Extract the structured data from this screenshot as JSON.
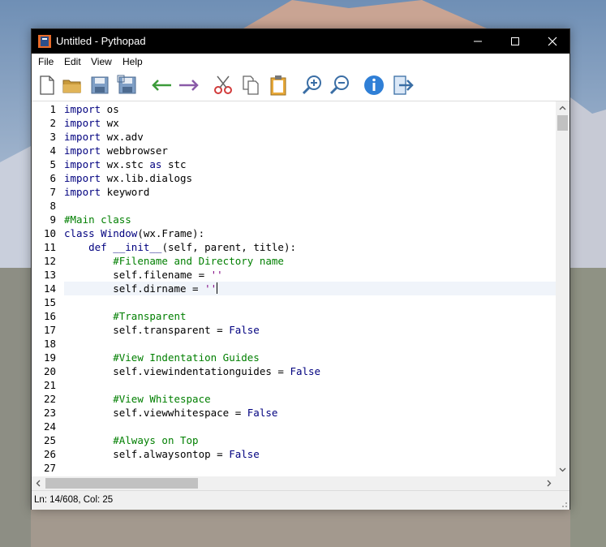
{
  "window": {
    "title": "Untitled - Pythopad"
  },
  "titlebar_controls": {
    "minimize": "—",
    "maximize": "☐",
    "close": "✕"
  },
  "menu": {
    "items": [
      "File",
      "Edit",
      "View",
      "Help"
    ]
  },
  "toolbar": {
    "buttons": [
      "new-file",
      "open-folder",
      "save",
      "save-as",
      "undo-arrow",
      "redo-arrow",
      "cut",
      "copy",
      "paste",
      "zoom-in",
      "zoom-out",
      "about-info",
      "exit"
    ]
  },
  "editor": {
    "lines": [
      {
        "n": "1",
        "t": "import os"
      },
      {
        "n": "2",
        "t": "import wx"
      },
      {
        "n": "3",
        "t": "import wx.adv"
      },
      {
        "n": "4",
        "t": "import webbrowser"
      },
      {
        "n": "5",
        "t": "import wx.stc as stc"
      },
      {
        "n": "6",
        "t": "import wx.lib.dialogs"
      },
      {
        "n": "7",
        "t": "import keyword"
      },
      {
        "n": "8",
        "t": ""
      },
      {
        "n": "9",
        "t": "#Main class"
      },
      {
        "n": "10",
        "t": "class Window(wx.Frame):"
      },
      {
        "n": "11",
        "t": "    def __init__(self, parent, title):"
      },
      {
        "n": "12",
        "t": "        #Filename and Directory name"
      },
      {
        "n": "13",
        "t": "        self.filename = ''"
      },
      {
        "n": "14",
        "t": "        self.dirname = ''"
      },
      {
        "n": "15",
        "t": ""
      },
      {
        "n": "16",
        "t": "        #Transparent"
      },
      {
        "n": "17",
        "t": "        self.transparent = False"
      },
      {
        "n": "18",
        "t": ""
      },
      {
        "n": "19",
        "t": "        #View Indentation Guides"
      },
      {
        "n": "20",
        "t": "        self.viewindentationguides = False"
      },
      {
        "n": "21",
        "t": ""
      },
      {
        "n": "22",
        "t": "        #View Whitespace"
      },
      {
        "n": "23",
        "t": "        self.viewwhitespace = False"
      },
      {
        "n": "24",
        "t": ""
      },
      {
        "n": "25",
        "t": "        #Always on Top"
      },
      {
        "n": "26",
        "t": "        self.alwaysontop = False"
      },
      {
        "n": "27",
        "t": ""
      }
    ]
  },
  "status": {
    "text": "Ln: 14/608, Col: 25"
  },
  "colors": {
    "keyword": "#00007f",
    "comment": "#007f00",
    "string": "#7f007f",
    "titlebar": "#000000"
  }
}
